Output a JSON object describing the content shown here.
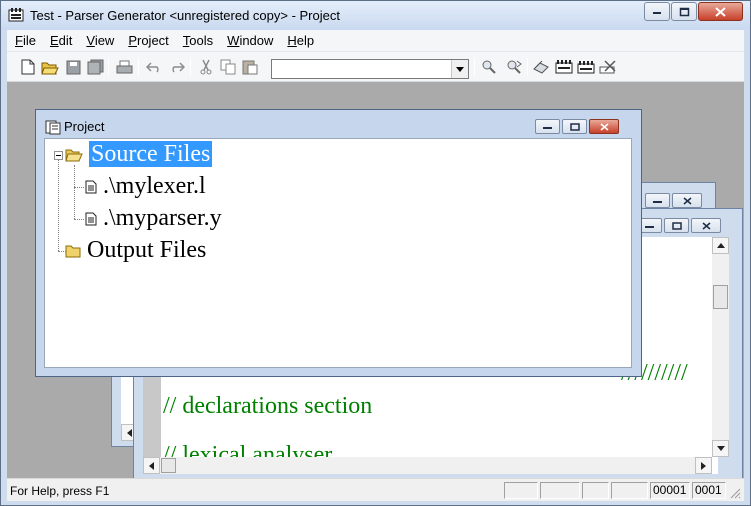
{
  "app": {
    "title": "Test - Parser Generator <unregistered copy> - Project"
  },
  "menubar": {
    "items": [
      {
        "key": "F",
        "rest": "ile"
      },
      {
        "key": "E",
        "rest": "dit"
      },
      {
        "key": "V",
        "rest": "iew"
      },
      {
        "key": "P",
        "rest": "roject"
      },
      {
        "key": "T",
        "rest": "ools"
      },
      {
        "key": "W",
        "rest": "indow"
      },
      {
        "key": "H",
        "rest": "elp"
      }
    ]
  },
  "toolbar": {
    "combo_value": ""
  },
  "project_window": {
    "title": "Project",
    "tree": {
      "source_files": "Source Files",
      "file1": ".\\mylexer.l",
      "file2": ".\\myparser.y",
      "output_files": "Output Files"
    }
  },
  "editor_window": {
    "lines": {
      "slashes": "//////////",
      "declarations": "// declarations section",
      "partial": "// lexical analyser"
    }
  },
  "statusbar": {
    "help_text": "For Help, press F1",
    "line": "00001",
    "col": "0001"
  },
  "colors": {
    "selection": "#3399ff",
    "comment_green": "#008000",
    "mdi_background": "#aaaaaa"
  }
}
